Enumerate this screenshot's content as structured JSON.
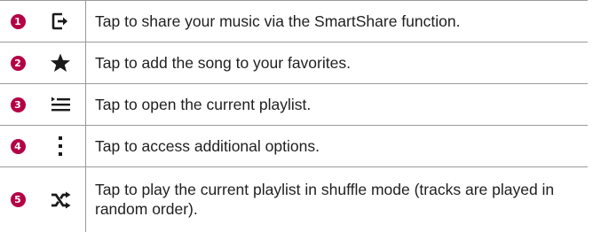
{
  "rows": [
    {
      "number": "1",
      "icon": "share-exit-icon",
      "text": "Tap to share your music via the SmartShare function."
    },
    {
      "number": "2",
      "icon": "star-icon",
      "text": "Tap to add the song to your favorites."
    },
    {
      "number": "3",
      "icon": "playlist-icon",
      "text": "Tap to open the current playlist."
    },
    {
      "number": "4",
      "icon": "more-vertical-icon",
      "text": "Tap to access additional options."
    },
    {
      "number": "5",
      "icon": "shuffle-icon",
      "text": "Tap to play the current playlist in shuffle mode (tracks are played in random order)."
    }
  ],
  "colors": {
    "number_badge": "#b40045",
    "icon": "#1a1a1a",
    "rule": "#9a9a9a"
  }
}
